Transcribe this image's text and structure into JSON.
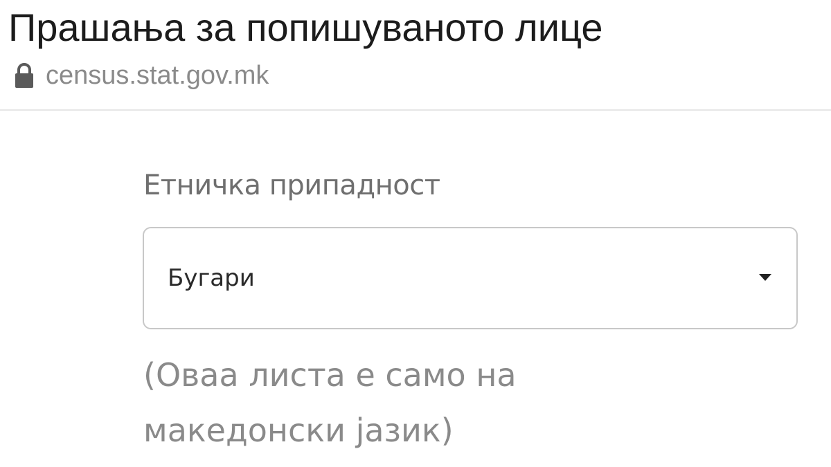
{
  "header": {
    "title": "Прашања за попишуваното лице",
    "url": "census.stat.gov.mk",
    "security_icon": "lock-icon"
  },
  "form": {
    "field_label": "Етничка припадност",
    "select": {
      "value": "Бугари",
      "icon": "caret-down-icon"
    },
    "hint": "(Оваа листа е само на македонски јазик)"
  }
}
